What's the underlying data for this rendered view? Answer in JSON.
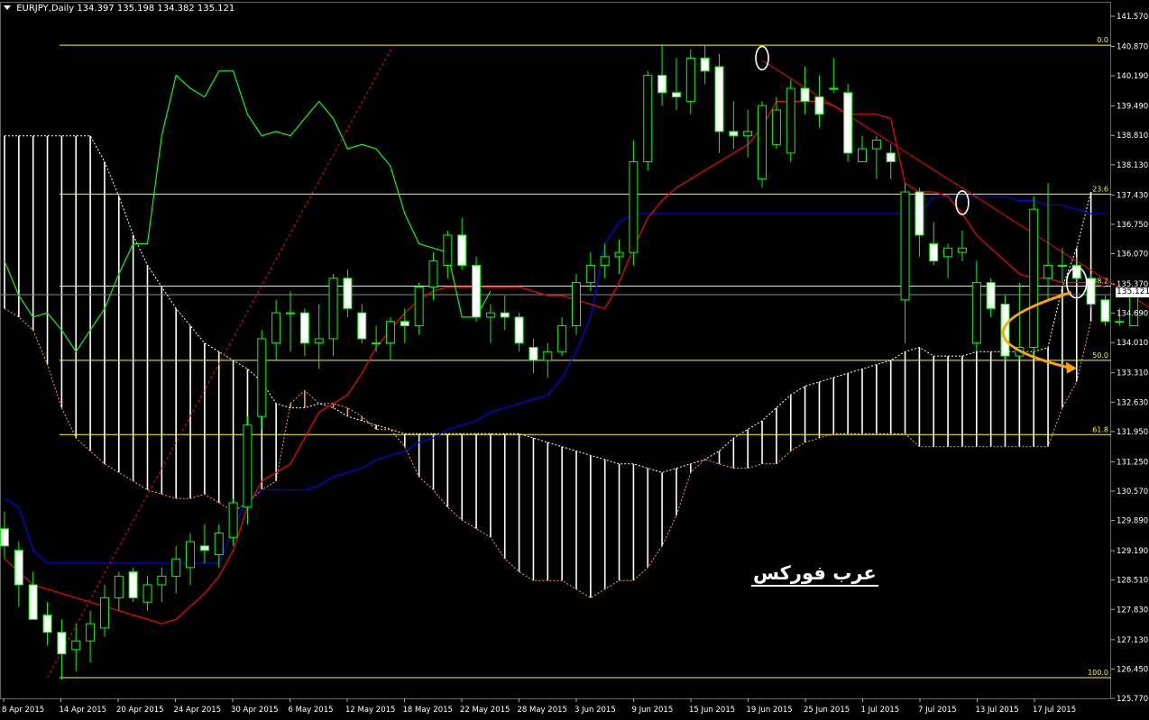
{
  "header": {
    "symbol": "EURJPY,Daily",
    "ohlc": "134.397 135.198 134.382 135.121"
  },
  "last_price_tag": "135.121",
  "watermark": "عرب فوركس",
  "colors": {
    "background": "#000000",
    "bull_candle": "#000000",
    "bear_candle": "#ffffff",
    "candle_outline": "#00ff00",
    "tenkan": "#ff0000",
    "kijun": "#0000ff",
    "chikou": "#00ff00",
    "kumo_bear": "#ffffff",
    "kumo_bull": "#ffa040",
    "fibo": "#ffff00",
    "annotation": "#ffa500"
  },
  "chart_data": {
    "type": "candlestick",
    "y_range": [
      125.77,
      141.57
    ],
    "y_ticks": [
      "141.570",
      "140.870",
      "140.190",
      "139.490",
      "138.810",
      "138.130",
      "137.430",
      "136.750",
      "136.070",
      "135.370",
      "134.690",
      "134.010",
      "133.310",
      "132.630",
      "131.950",
      "131.250",
      "130.570",
      "129.890",
      "129.190",
      "128.510",
      "127.830",
      "127.130",
      "126.450",
      "125.770"
    ],
    "x_labels": [
      "8 Apr 2015",
      "14 Apr 2015",
      "20 Apr 2015",
      "24 Apr 2015",
      "30 Apr 2015",
      "6 May 2015",
      "12 May 2015",
      "18 May 2015",
      "22 May 2015",
      "28 May 2015",
      "3 Jun 2015",
      "9 Jun 2015",
      "15 Jun 2015",
      "19 Jun 2015",
      "25 Jun 2015",
      "1 Jul 2015",
      "7 Jul 2015",
      "13 Jul 2015",
      "17 Jul 2015"
    ],
    "candles": [
      {
        "o": 129.7,
        "h": 130.1,
        "l": 129.0,
        "c": 129.3
      },
      {
        "o": 129.2,
        "h": 129.4,
        "l": 127.9,
        "c": 128.4
      },
      {
        "o": 128.4,
        "h": 128.7,
        "l": 127.6,
        "c": 127.6
      },
      {
        "o": 127.7,
        "h": 128.0,
        "l": 127.0,
        "c": 127.3
      },
      {
        "o": 127.3,
        "h": 127.6,
        "l": 126.2,
        "c": 126.8
      },
      {
        "o": 126.9,
        "h": 127.5,
        "l": 126.4,
        "c": 127.1
      },
      {
        "o": 127.1,
        "h": 127.8,
        "l": 126.6,
        "c": 127.5
      },
      {
        "o": 127.4,
        "h": 128.4,
        "l": 127.2,
        "c": 128.1
      },
      {
        "o": 128.1,
        "h": 128.7,
        "l": 127.8,
        "c": 128.6
      },
      {
        "o": 128.7,
        "h": 128.8,
        "l": 128.0,
        "c": 128.1
      },
      {
        "o": 128.0,
        "h": 128.6,
        "l": 127.8,
        "c": 128.4
      },
      {
        "o": 128.4,
        "h": 128.8,
        "l": 128.0,
        "c": 128.6
      },
      {
        "o": 128.6,
        "h": 129.3,
        "l": 128.2,
        "c": 129.0
      },
      {
        "o": 128.8,
        "h": 129.6,
        "l": 128.4,
        "c": 129.4
      },
      {
        "o": 129.3,
        "h": 129.8,
        "l": 128.9,
        "c": 129.2
      },
      {
        "o": 129.1,
        "h": 129.8,
        "l": 128.8,
        "c": 129.6
      },
      {
        "o": 129.5,
        "h": 130.4,
        "l": 129.3,
        "c": 130.3
      },
      {
        "o": 130.2,
        "h": 132.3,
        "l": 129.8,
        "c": 132.1
      },
      {
        "o": 132.3,
        "h": 134.3,
        "l": 132.0,
        "c": 134.1
      },
      {
        "o": 134.0,
        "h": 135.0,
        "l": 133.6,
        "c": 134.7
      },
      {
        "o": 134.7,
        "h": 135.2,
        "l": 133.8,
        "c": 134.7
      },
      {
        "o": 134.7,
        "h": 134.8,
        "l": 133.7,
        "c": 134.0
      },
      {
        "o": 134.0,
        "h": 134.9,
        "l": 133.4,
        "c": 134.1
      },
      {
        "o": 134.1,
        "h": 135.6,
        "l": 133.7,
        "c": 135.5
      },
      {
        "o": 135.5,
        "h": 135.7,
        "l": 134.6,
        "c": 134.8
      },
      {
        "o": 134.7,
        "h": 134.9,
        "l": 134.0,
        "c": 134.1
      },
      {
        "o": 134.0,
        "h": 134.4,
        "l": 133.8,
        "c": 134.0
      },
      {
        "o": 134.0,
        "h": 134.6,
        "l": 133.6,
        "c": 134.5
      },
      {
        "o": 134.5,
        "h": 134.8,
        "l": 134.0,
        "c": 134.4
      },
      {
        "o": 134.4,
        "h": 135.4,
        "l": 134.2,
        "c": 135.3
      },
      {
        "o": 135.3,
        "h": 136.1,
        "l": 135.0,
        "c": 135.9
      },
      {
        "o": 135.8,
        "h": 136.6,
        "l": 135.5,
        "c": 136.5
      },
      {
        "o": 136.5,
        "h": 136.9,
        "l": 135.7,
        "c": 135.8
      },
      {
        "o": 135.8,
        "h": 136.0,
        "l": 134.5,
        "c": 134.6
      },
      {
        "o": 134.6,
        "h": 134.9,
        "l": 134.0,
        "c": 134.7
      },
      {
        "o": 134.7,
        "h": 135.1,
        "l": 134.3,
        "c": 134.6
      },
      {
        "o": 134.6,
        "h": 134.7,
        "l": 133.8,
        "c": 134.0
      },
      {
        "o": 133.9,
        "h": 134.1,
        "l": 133.3,
        "c": 133.6
      },
      {
        "o": 133.6,
        "h": 134.0,
        "l": 133.2,
        "c": 133.8
      },
      {
        "o": 133.8,
        "h": 134.6,
        "l": 133.7,
        "c": 134.4
      },
      {
        "o": 134.4,
        "h": 135.6,
        "l": 134.2,
        "c": 135.4
      },
      {
        "o": 135.4,
        "h": 136.1,
        "l": 135.2,
        "c": 135.8
      },
      {
        "o": 135.8,
        "h": 136.3,
        "l": 135.5,
        "c": 136.0
      },
      {
        "o": 136.0,
        "h": 136.4,
        "l": 135.6,
        "c": 136.1
      },
      {
        "o": 136.1,
        "h": 138.7,
        "l": 135.8,
        "c": 138.2
      },
      {
        "o": 138.2,
        "h": 140.3,
        "l": 138.0,
        "c": 140.2
      },
      {
        "o": 140.2,
        "h": 140.9,
        "l": 139.5,
        "c": 139.8
      },
      {
        "o": 139.8,
        "h": 140.6,
        "l": 139.4,
        "c": 139.7
      },
      {
        "o": 139.6,
        "h": 140.8,
        "l": 139.3,
        "c": 140.6
      },
      {
        "o": 140.6,
        "h": 140.9,
        "l": 140.0,
        "c": 140.3
      },
      {
        "o": 140.4,
        "h": 140.7,
        "l": 138.4,
        "c": 138.9
      },
      {
        "o": 138.9,
        "h": 139.6,
        "l": 138.5,
        "c": 138.8
      },
      {
        "o": 138.8,
        "h": 139.4,
        "l": 138.3,
        "c": 138.9
      },
      {
        "o": 137.8,
        "h": 139.6,
        "l": 137.6,
        "c": 139.5
      },
      {
        "o": 138.6,
        "h": 139.7,
        "l": 138.5,
        "c": 139.4
      },
      {
        "o": 138.4,
        "h": 140.1,
        "l": 138.2,
        "c": 139.9
      },
      {
        "o": 139.9,
        "h": 140.4,
        "l": 139.3,
        "c": 139.6
      },
      {
        "o": 139.7,
        "h": 140.2,
        "l": 139.0,
        "c": 139.3
      },
      {
        "o": 139.9,
        "h": 140.6,
        "l": 139.8,
        "c": 139.9
      },
      {
        "o": 139.8,
        "h": 140.0,
        "l": 138.2,
        "c": 138.4
      },
      {
        "o": 138.2,
        "h": 138.8,
        "l": 138.2,
        "c": 138.5
      },
      {
        "o": 138.5,
        "h": 138.8,
        "l": 137.8,
        "c": 138.7
      },
      {
        "o": 138.4,
        "h": 138.6,
        "l": 137.8,
        "c": 138.2
      },
      {
        "o": 135.0,
        "h": 137.7,
        "l": 134.0,
        "c": 137.5
      },
      {
        "o": 137.5,
        "h": 137.6,
        "l": 136.0,
        "c": 136.5
      },
      {
        "o": 136.3,
        "h": 136.8,
        "l": 135.8,
        "c": 135.9
      },
      {
        "o": 136.0,
        "h": 136.3,
        "l": 135.5,
        "c": 136.2
      },
      {
        "o": 136.1,
        "h": 136.6,
        "l": 135.9,
        "c": 136.2
      },
      {
        "o": 134.0,
        "h": 135.9,
        "l": 133.8,
        "c": 135.4
      },
      {
        "o": 135.4,
        "h": 135.5,
        "l": 134.6,
        "c": 134.8
      },
      {
        "o": 134.9,
        "h": 135.1,
        "l": 133.6,
        "c": 133.7
      },
      {
        "o": 133.7,
        "h": 135.4,
        "l": 133.6,
        "c": 133.9
      },
      {
        "o": 133.9,
        "h": 137.4,
        "l": 133.7,
        "c": 137.1
      },
      {
        "o": 135.5,
        "h": 137.7,
        "l": 135.0,
        "c": 135.8
      },
      {
        "o": 135.8,
        "h": 136.2,
        "l": 135.4,
        "c": 135.8
      },
      {
        "o": 135.8,
        "h": 136.0,
        "l": 135.4,
        "c": 135.5
      },
      {
        "o": 135.5,
        "h": 135.6,
        "l": 134.8,
        "c": 134.9
      },
      {
        "o": 135.0,
        "h": 135.1,
        "l": 134.4,
        "c": 134.5
      },
      {
        "o": 134.5,
        "h": 134.8,
        "l": 134.4,
        "c": 134.5
      },
      {
        "o": 134.4,
        "h": 135.2,
        "l": 134.4,
        "c": 135.12
      }
    ],
    "tenkan": [
      129.0,
      128.7,
      128.4,
      128.3,
      128.2,
      128.1,
      128.0,
      127.9,
      127.8,
      127.7,
      127.6,
      127.5,
      127.6,
      127.9,
      128.2,
      128.6,
      129.2,
      130.2,
      130.8,
      131.0,
      131.2,
      131.8,
      132.4,
      132.6,
      132.8,
      133.3,
      133.9,
      134.3,
      134.7,
      135.0,
      135.2,
      135.3,
      135.3,
      135.3,
      135.3,
      135.3,
      135.3,
      135.2,
      135.1,
      135.1,
      135.0,
      134.9,
      134.8,
      135.4,
      136.2,
      136.9,
      137.3,
      137.6,
      137.8,
      138.0,
      138.2,
      138.4,
      138.6,
      139.0,
      139.6,
      139.6,
      139.6,
      139.6,
      139.5,
      139.3,
      139.3,
      139.3,
      139.2,
      137.7,
      137.5,
      137.5,
      137.4,
      137.0,
      136.5,
      136.2,
      135.9,
      135.6,
      135.5,
      135.5,
      135.4,
      135.4,
      135.4,
      135.3,
      135.3,
      135.2,
      135.2
    ],
    "kijun": [
      130.4,
      130.2,
      129.2,
      128.9,
      128.9,
      128.9,
      128.9,
      128.9,
      128.9,
      128.9,
      128.9,
      128.9,
      128.9,
      128.9,
      128.9,
      128.9,
      129.7,
      130.4,
      130.6,
      130.6,
      130.6,
      130.6,
      130.7,
      130.9,
      131.0,
      131.1,
      131.3,
      131.4,
      131.5,
      131.7,
      131.8,
      132.0,
      132.1,
      132.2,
      132.4,
      132.5,
      132.6,
      132.7,
      132.8,
      133.2,
      133.8,
      134.6,
      136.3,
      136.8,
      137.0,
      137.0,
      137.0,
      137.0,
      137.0,
      137.0,
      137.0,
      137.0,
      137.0,
      137.0,
      137.0,
      137.0,
      137.0,
      137.0,
      137.0,
      137.0,
      137.0,
      137.0,
      137.0,
      137.0,
      137.0,
      137.4,
      137.4,
      137.4,
      137.4,
      137.4,
      137.4,
      137.3,
      137.3,
      137.2,
      137.2,
      137.1,
      137.0,
      137.0,
      137.0,
      137.0,
      137.0
    ],
    "chikou": [
      135.9,
      135.1,
      134.6,
      134.7,
      134.3,
      133.8,
      134.3,
      134.8,
      135.6,
      136.3,
      136.3,
      138.8,
      140.2,
      139.9,
      139.7,
      140.3,
      140.3,
      139.3,
      138.8,
      138.9,
      138.8,
      139.2,
      139.6,
      139.2,
      138.5,
      138.6,
      138.5,
      138.1,
      137.0,
      136.3,
      136.2,
      136.1,
      134.6,
      134.6,
      135.2
    ],
    "kumo_a": [
      138.8,
      138.8,
      138.8,
      138.8,
      138.8,
      138.8,
      138.8,
      138.2,
      137.4,
      136.5,
      135.8,
      135.3,
      134.8,
      134.4,
      134.0,
      133.8,
      133.6,
      133.4,
      133.1,
      132.6,
      132.5,
      132.5,
      132.6,
      132.5,
      132.3,
      132.2,
      132.1,
      132.0,
      131.9,
      131.9,
      131.9,
      131.9,
      131.9,
      131.9,
      131.9,
      131.9,
      131.9,
      131.8,
      131.7,
      131.6,
      131.5,
      131.4,
      131.3,
      131.2,
      131.2,
      131.1,
      131.0,
      131.1,
      131.2,
      131.3,
      131.5,
      131.8,
      132.0,
      132.2,
      132.5,
      132.8,
      133.0,
      133.1,
      133.2,
      133.3,
      133.4,
      133.5,
      133.6,
      133.8,
      133.9,
      133.7,
      133.7,
      133.7,
      133.8,
      133.8,
      133.8,
      133.8,
      133.8,
      133.9,
      135.3,
      136.2,
      137.5,
      137.5,
      137.6,
      137.6,
      138.2,
      138.2,
      138.3,
      138.3
    ],
    "kumo_b": [
      134.8,
      134.6,
      134.3,
      133.5,
      132.5,
      131.8,
      131.5,
      131.2,
      131.0,
      130.8,
      130.6,
      130.5,
      130.4,
      130.4,
      130.5,
      130.3,
      130.1,
      130.3,
      130.6,
      130.8,
      132.6,
      132.9,
      132.6,
      132.6,
      132.5,
      132.3,
      132.0,
      132.0,
      131.6,
      130.9,
      130.6,
      130.2,
      129.9,
      129.7,
      129.5,
      129.0,
      128.7,
      128.5,
      128.5,
      128.5,
      128.3,
      128.1,
      128.3,
      128.5,
      128.5,
      128.8,
      129.3,
      130.0,
      131.0,
      131.3,
      131.2,
      131.1,
      131.1,
      131.2,
      131.2,
      131.5,
      131.7,
      131.8,
      131.9,
      131.9,
      131.9,
      131.9,
      131.9,
      131.9,
      131.6,
      131.6,
      131.6,
      131.6,
      131.6,
      131.6,
      131.6,
      131.6,
      131.6,
      131.6,
      132.5,
      133.1,
      134.5,
      135.3,
      136.3,
      136.7,
      138.2,
      138.2,
      138.2,
      138.2
    ],
    "fibo_levels": [
      {
        "label": "0.0",
        "price": 140.9
      },
      {
        "label": "23.6",
        "price": 137.45
      },
      {
        "label": "38.2",
        "price": 135.32
      },
      {
        "label": "50.0",
        "price": 133.6
      },
      {
        "label": "61.8",
        "price": 131.88
      },
      {
        "label": "100.0",
        "price": 126.25
      }
    ],
    "trendlines": [
      {
        "style": "dotted",
        "color": "#ff0000",
        "from": {
          "bar": 3,
          "price": 126.25
        },
        "to": {
          "bar": 27,
          "price": 140.9
        }
      },
      {
        "style": "solid",
        "color": "#ff0000",
        "from": {
          "bar": 53,
          "price": 140.55
        },
        "to": {
          "bar": 80,
          "price": 134.8
        }
      }
    ],
    "circles": [
      {
        "bar": 53,
        "price": 140.6
      },
      {
        "bar": 67,
        "price": 137.25
      },
      {
        "bar": 75,
        "price": 135.4
      }
    ],
    "annotation_curve": {
      "color": "#ffa500",
      "from": {
        "bar": 75,
        "price": 135.3
      },
      "via": {
        "bar": 69,
        "price": 134.2
      },
      "to": {
        "bar": 74,
        "price": 133.5
      }
    },
    "last_price": 135.121
  }
}
